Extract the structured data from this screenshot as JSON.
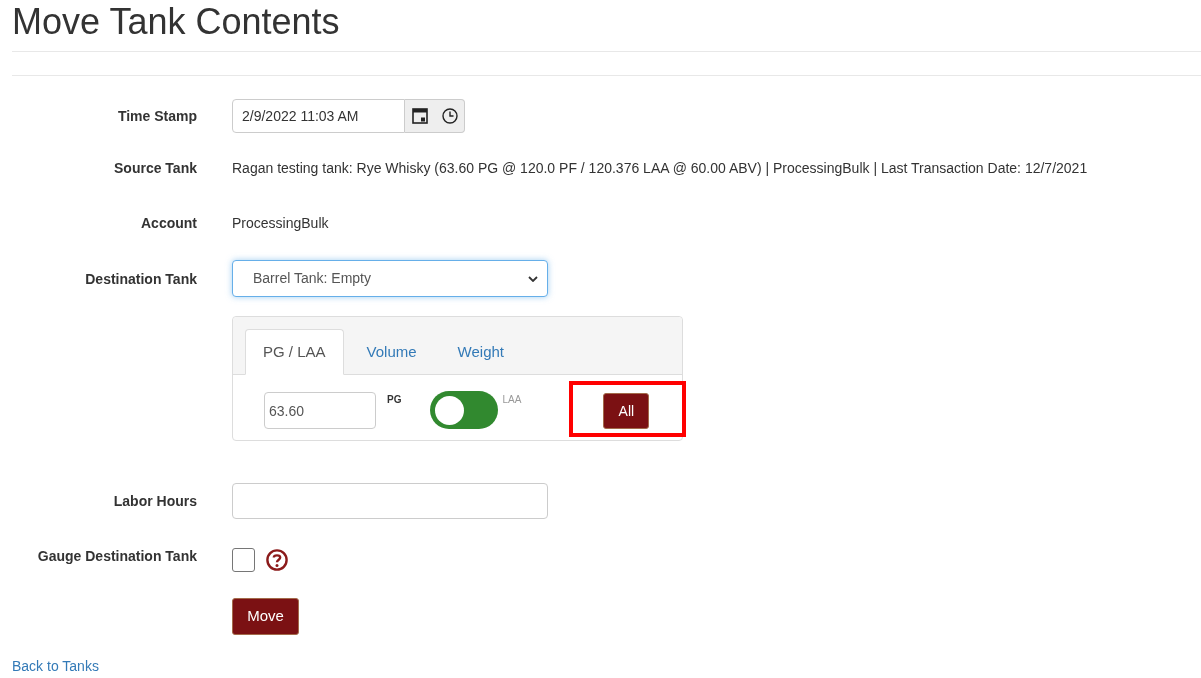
{
  "page": {
    "title": "Move Tank Contents"
  },
  "form": {
    "time_stamp": {
      "label": "Time Stamp",
      "value": "2/9/2022 11:03 AM"
    },
    "source_tank": {
      "label": "Source Tank",
      "value": "Ragan testing tank: Rye Whisky (63.60 PG @ 120.0 PF / 120.376 LAA @ 60.00 ABV) | ProcessingBulk | Last Transaction Date: 12/7/2021"
    },
    "account": {
      "label": "Account",
      "value": "ProcessingBulk"
    },
    "destination_tank": {
      "label": "Destination Tank",
      "value": "Barrel Tank: Empty",
      "focused": true
    },
    "quantity_panel": {
      "tabs": [
        {
          "label": "PG / LAA",
          "selected": true
        },
        {
          "label": "Volume",
          "selected": false
        },
        {
          "label": "Weight",
          "selected": false
        }
      ],
      "amount": {
        "value": "63.60"
      },
      "unit_toggle": {
        "left_label": "PG",
        "right_label": "LAA",
        "on": false
      },
      "all_button": {
        "label": "All",
        "highlighted": true
      }
    },
    "labor_hours": {
      "label": "Labor Hours"
    },
    "gauge_destination_tank": {
      "label": "Gauge Destination Tank",
      "checked": false
    },
    "submit_button": {
      "label": "Move"
    }
  },
  "back_link": {
    "label": "Back to Tanks"
  }
}
